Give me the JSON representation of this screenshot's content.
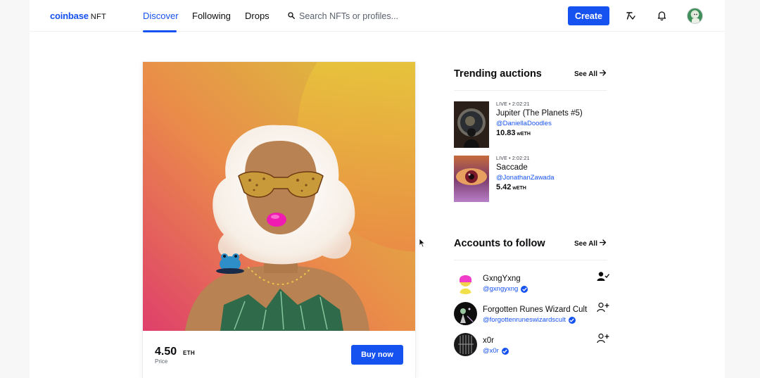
{
  "header": {
    "logo_text": "coinbase",
    "logo_suffix": "NFT",
    "tabs": [
      {
        "label": "Discover"
      },
      {
        "label": "Following"
      },
      {
        "label": "Drops"
      }
    ],
    "search_placeholder": "Search NFTs or profiles...",
    "create_label": "Create"
  },
  "featured": {
    "price": "4.50",
    "currency": "ETH",
    "price_label": "Price",
    "buy_label": "Buy now"
  },
  "trending": {
    "title": "Trending auctions",
    "see_all": "See All",
    "items": [
      {
        "status": "LIVE • 2:02:21",
        "name": "Jupiter (The Planets #5)",
        "handle": "@DaniellaDoodles",
        "amount": "10.83",
        "unit": "wETH"
      },
      {
        "status": "LIVE • 2:02:21",
        "name": "Saccade",
        "handle": "@JonathanZawada",
        "amount": "5.42",
        "unit": "wETH"
      }
    ]
  },
  "accounts": {
    "title": "Accounts to follow",
    "see_all": "See All",
    "items": [
      {
        "name": "GxngYxng",
        "handle": "@gxngyxng"
      },
      {
        "name": "Forgotten Runes Wizard Cult",
        "handle": "@forgottenruneswizardscult"
      },
      {
        "name": "x0r",
        "handle": "@x0r"
      }
    ]
  },
  "colors": {
    "brand": "#1652f0",
    "text": "#0a0b0d",
    "muted": "#5b616e"
  },
  "icons": [
    "search-icon",
    "activity-icon",
    "bell-icon",
    "arrow-right-icon",
    "verified-icon",
    "user-check-icon",
    "user-plus-icon"
  ]
}
